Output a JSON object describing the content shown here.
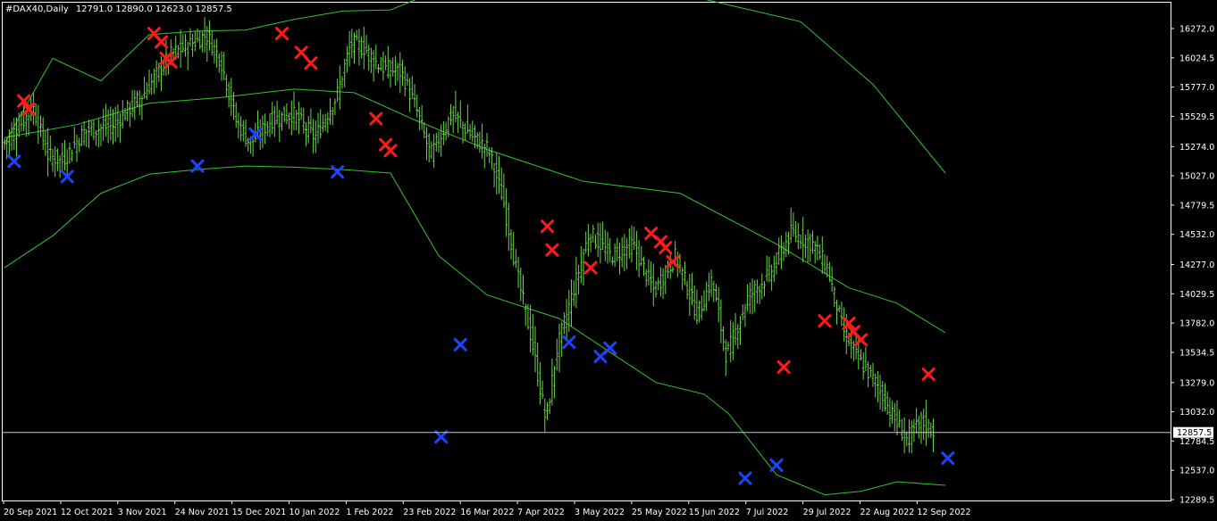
{
  "header": {
    "symbol": "#DAX40,Daily",
    "ohlc": "12791.0 12890.0 12623.0 12857.5"
  },
  "colors": {
    "background": "#000000",
    "border": "#ffffff",
    "bars": "#6dd34a",
    "bands": "#34c234",
    "sell_marker": "#ff1a1a",
    "buy_marker": "#1b44ff",
    "current_price_line": "#c8c8c8",
    "current_price_tag": "#ffffff"
  },
  "chart_data": {
    "type": "ohlc",
    "title": "#DAX40,Daily",
    "ylim": [
      12289.0,
      16520.0
    ],
    "y_ticks": [
      "16272.0",
      "16024.5",
      "15777.0",
      "15529.5",
      "15274.0",
      "15027.0",
      "14779.5",
      "14532.0",
      "14277.0",
      "14029.5",
      "13782.0",
      "13534.5",
      "13279.0",
      "13032.0",
      "12784.5",
      "12537.0",
      "12289.5"
    ],
    "x_ticks": [
      "20 Sep 2021",
      "12 Oct 2021",
      "3 Nov 2021",
      "24 Nov 2021",
      "15 Dec 2021",
      "10 Jan 2022",
      "1 Feb 2022",
      "23 Feb 2022",
      "16 Mar 2022",
      "7 Apr 2022",
      "3 May 2022",
      "25 May 2022",
      "15 Jun 2022",
      "7 Jul 2022",
      "29 Jul 2022",
      "22 Aug 2022",
      "12 Sep 2022"
    ],
    "current_price": "12857.5",
    "bar_count": 260,
    "price_anchors": [
      [
        0,
        15300
      ],
      [
        8,
        15600
      ],
      [
        12,
        15200
      ],
      [
        16,
        15150
      ],
      [
        22,
        15400
      ],
      [
        30,
        15450
      ],
      [
        38,
        15700
      ],
      [
        46,
        16050
      ],
      [
        52,
        16150
      ],
      [
        56,
        16220
      ],
      [
        60,
        16000
      ],
      [
        64,
        15500
      ],
      [
        68,
        15300
      ],
      [
        74,
        15500
      ],
      [
        80,
        15550
      ],
      [
        86,
        15350
      ],
      [
        92,
        15700
      ],
      [
        96,
        16150
      ],
      [
        100,
        16100
      ],
      [
        104,
        15950
      ],
      [
        110,
        15900
      ],
      [
        114,
        15600
      ],
      [
        118,
        15200
      ],
      [
        124,
        15550
      ],
      [
        130,
        15350
      ],
      [
        134,
        15250
      ],
      [
        138,
        14850
      ],
      [
        142,
        14200
      ],
      [
        146,
        13650
      ],
      [
        150,
        12950
      ],
      [
        153,
        13550
      ],
      [
        158,
        14100
      ],
      [
        162,
        14550
      ],
      [
        168,
        14350
      ],
      [
        174,
        14450
      ],
      [
        180,
        14050
      ],
      [
        186,
        14350
      ],
      [
        192,
        13850
      ],
      [
        196,
        14150
      ],
      [
        200,
        13500
      ],
      [
        206,
        14000
      ],
      [
        212,
        14200
      ],
      [
        218,
        14550
      ],
      [
        224,
        14450
      ],
      [
        228,
        14250
      ],
      [
        232,
        13750
      ],
      [
        236,
        13500
      ],
      [
        242,
        13250
      ],
      [
        246,
        13000
      ],
      [
        250,
        12800
      ],
      [
        254,
        12950
      ],
      [
        258,
        12850
      ]
    ],
    "sell_markers": [
      {
        "bar": 8,
        "price": 15660
      },
      {
        "bar": 10,
        "price": 15590
      },
      {
        "bar": 62,
        "price": 16230
      },
      {
        "bar": 65,
        "price": 16160
      },
      {
        "bar": 67,
        "price": 16020
      },
      {
        "bar": 69,
        "price": 15990
      },
      {
        "bar": 115,
        "price": 16230
      },
      {
        "bar": 123,
        "price": 16070
      },
      {
        "bar": 127,
        "price": 15980
      },
      {
        "bar": 154,
        "price": 15510
      },
      {
        "bar": 158,
        "price": 15290
      },
      {
        "bar": 160,
        "price": 15240
      },
      {
        "bar": 225,
        "price": 14600
      },
      {
        "bar": 227,
        "price": 14400
      },
      {
        "bar": 243,
        "price": 14250
      },
      {
        "bar": 268,
        "price": 14540
      },
      {
        "bar": 272,
        "price": 14470
      },
      {
        "bar": 274,
        "price": 14420
      },
      {
        "bar": 277,
        "price": 14300
      },
      {
        "bar": 323,
        "price": 13410
      },
      {
        "bar": 340,
        "price": 13800
      },
      {
        "bar": 350,
        "price": 13780
      },
      {
        "bar": 352,
        "price": 13710
      },
      {
        "bar": 355,
        "price": 13640
      },
      {
        "bar": 383,
        "price": 13350
      }
    ],
    "buy_markers": [
      {
        "bar": 4,
        "price": 15150
      },
      {
        "bar": 26,
        "price": 15020
      },
      {
        "bar": 80,
        "price": 15110
      },
      {
        "bar": 104,
        "price": 15380
      },
      {
        "bar": 138,
        "price": 15060
      },
      {
        "bar": 181,
        "price": 12820
      },
      {
        "bar": 189,
        "price": 13600
      },
      {
        "bar": 234,
        "price": 13620
      },
      {
        "bar": 247,
        "price": 13500
      },
      {
        "bar": 251,
        "price": 13570
      },
      {
        "bar": 307,
        "price": 12470
      },
      {
        "bar": 320,
        "price": 12580
      },
      {
        "bar": 391,
        "price": 12640
      }
    ],
    "upper_band": [
      [
        0,
        15300
      ],
      [
        20,
        16020
      ],
      [
        40,
        15830
      ],
      [
        60,
        16220
      ],
      [
        80,
        16250
      ],
      [
        100,
        16260
      ],
      [
        120,
        16350
      ],
      [
        140,
        16420
      ],
      [
        160,
        16430
      ],
      [
        178,
        16580
      ]
    ],
    "middle_band": [
      [
        0,
        15350
      ],
      [
        30,
        15460
      ],
      [
        60,
        15640
      ],
      [
        90,
        15690
      ],
      [
        120,
        15760
      ],
      [
        145,
        15730
      ],
      [
        170,
        15500
      ],
      [
        200,
        15250
      ],
      [
        240,
        14980
      ],
      [
        280,
        14880
      ],
      [
        320,
        14450
      ],
      [
        350,
        14080
      ],
      [
        370,
        13950
      ],
      [
        390,
        13700
      ]
    ],
    "lower_band": [
      [
        0,
        14250
      ],
      [
        20,
        14520
      ],
      [
        40,
        14880
      ],
      [
        60,
        15040
      ],
      [
        80,
        15080
      ],
      [
        100,
        15110
      ],
      [
        120,
        15100
      ],
      [
        140,
        15080
      ],
      [
        160,
        15050
      ],
      [
        170,
        14700
      ],
      [
        180,
        14350
      ],
      [
        200,
        14020
      ],
      [
        230,
        13820
      ],
      [
        250,
        13550
      ],
      [
        270,
        13280
      ],
      [
        290,
        13180
      ],
      [
        300,
        13020
      ],
      [
        320,
        12500
      ],
      [
        340,
        12330
      ],
      [
        355,
        12360
      ],
      [
        370,
        12440
      ],
      [
        390,
        12410
      ]
    ],
    "upper_band_right": [
      [
        290,
        16520
      ],
      [
        330,
        16330
      ],
      [
        360,
        15800
      ],
      [
        390,
        15050
      ]
    ]
  }
}
